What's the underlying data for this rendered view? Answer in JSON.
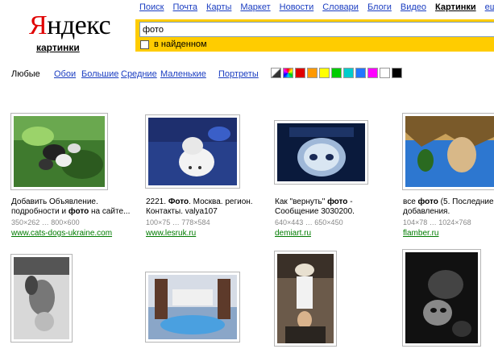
{
  "logo": {
    "first": "Я",
    "rest": "ндекс"
  },
  "service": "картинки",
  "nav": {
    "items": [
      "Поиск",
      "Почта",
      "Карты",
      "Маркет",
      "Новости",
      "Словари",
      "Блоги",
      "Видео"
    ],
    "active": "Картинки",
    "more": "ещё"
  },
  "search": {
    "value": "фото",
    "within_label": "в найденном"
  },
  "filters": {
    "any": "Любые",
    "wallpapers": "Обои",
    "large": "Большие",
    "medium": "Средние",
    "small": "Маленькие",
    "portraits": "Портреты"
  },
  "colors": [
    "#888888",
    "#ff0000",
    "#e00000",
    "#ff9900",
    "#ffff00",
    "#00cc00",
    "#00cccc",
    "#2277ff",
    "#ff00ff",
    "#ffffff",
    "#000000"
  ],
  "results": [
    {
      "caption": "Добавить Объявление. подробности и ",
      "bold": "фото",
      "caption_tail": " на сайте...",
      "meta": "350×262 … 800×600",
      "link": "www.cats-dogs-ukraine.com"
    },
    {
      "caption": "2221. ",
      "bold": "Фото",
      "caption_tail": ". Москва. регион. Контакты. valya107",
      "meta": "100×75 … 778×584",
      "link": "www.lesruk.ru"
    },
    {
      "caption": "Как \"вернуть\" ",
      "bold": "фото",
      "caption_tail": " - Сообщение 3030200.",
      "meta": "640×443 … 650×450",
      "link": "demiart.ru"
    },
    {
      "caption": "все ",
      "bold": "фото",
      "caption_tail": " (5. Последние добавления.",
      "meta": "104×78 … 1024×768",
      "link": "flamber.ru"
    }
  ]
}
